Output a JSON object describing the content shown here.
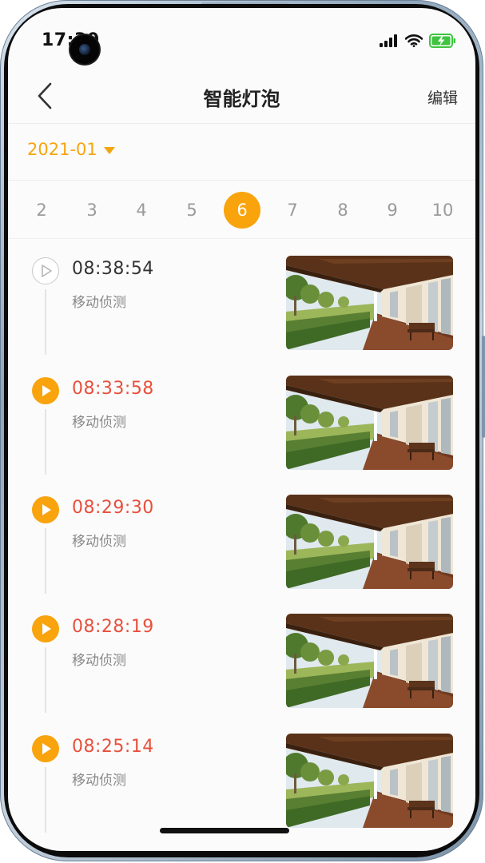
{
  "status_bar": {
    "time": "17:30",
    "battery_color": "#3ec43e"
  },
  "nav": {
    "title": "智能灯泡",
    "edit_label": "编辑"
  },
  "month": {
    "label": "2021-01"
  },
  "days": [
    "2",
    "3",
    "4",
    "5",
    "6",
    "7",
    "8",
    "9",
    "10"
  ],
  "selected_day": "6",
  "events": [
    {
      "time": "08:38:54",
      "event": "移动侦测",
      "state": "read"
    },
    {
      "time": "08:33:58",
      "event": "移动侦测",
      "state": "unread"
    },
    {
      "time": "08:29:30",
      "event": "移动侦测",
      "state": "unread"
    },
    {
      "time": "08:28:19",
      "event": "移动侦测",
      "state": "unread"
    },
    {
      "time": "08:25:14",
      "event": "移动侦测",
      "state": "unread"
    }
  ],
  "colors": {
    "accent": "#f9a30d",
    "unread_time": "#e8503c",
    "read_time": "#333333"
  },
  "icons": {
    "back": "chevron-left-icon",
    "dropdown": "caret-down-icon",
    "play": "play-icon",
    "signal": "signal-icon",
    "wifi": "wifi-icon",
    "battery": "battery-charging-icon"
  }
}
